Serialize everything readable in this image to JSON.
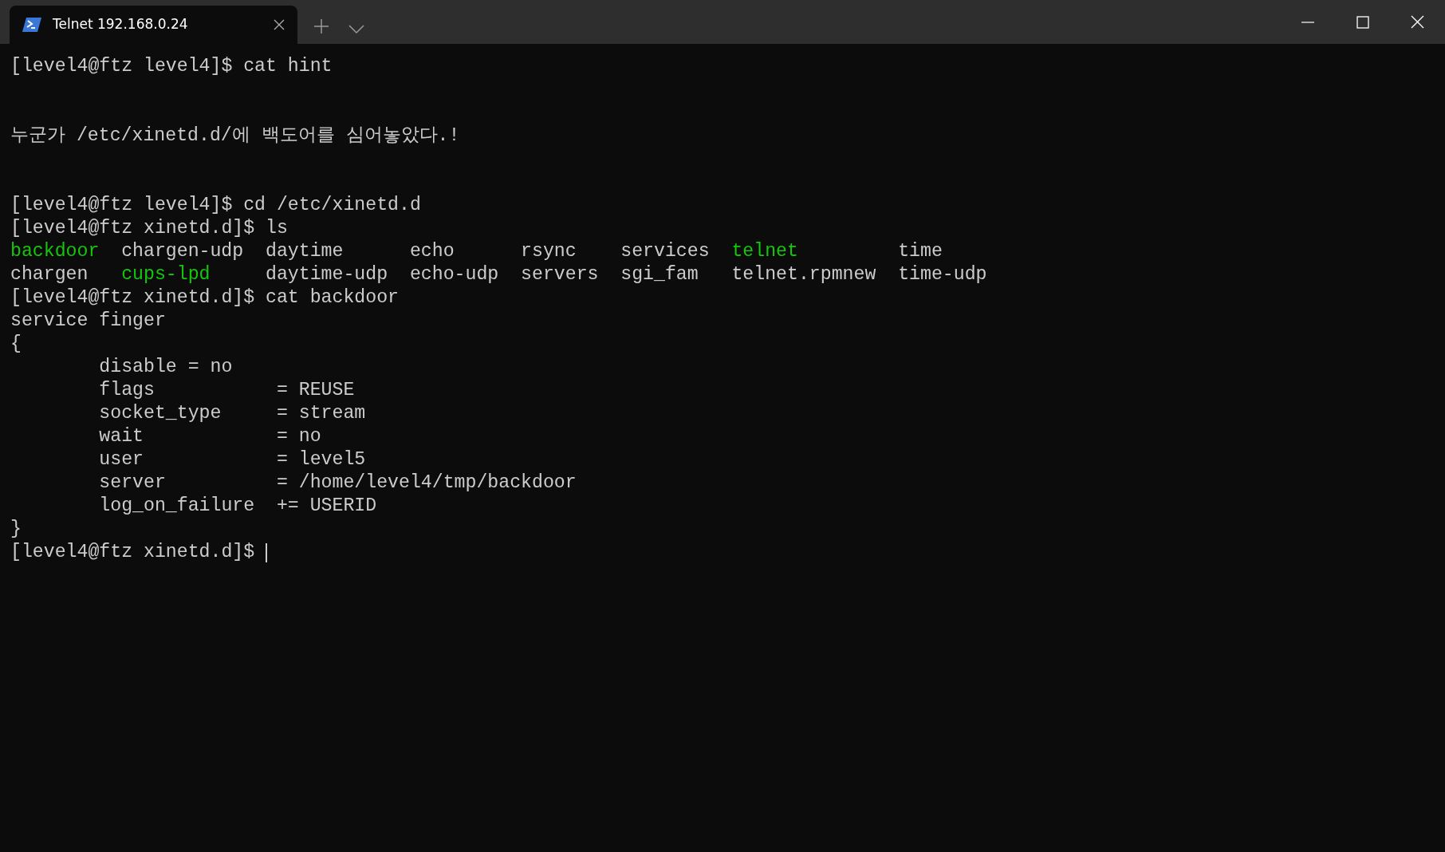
{
  "tab": {
    "title": "Telnet 192.168.0.24",
    "selected": true
  },
  "lines": [
    {
      "kind": "text",
      "text": "[level4@ftz level4]$ cat hint"
    },
    {
      "kind": "blank"
    },
    {
      "kind": "blank"
    },
    {
      "kind": "text",
      "text": "누군가 /etc/xinetd.d/에 백도어를 심어놓았다.!"
    },
    {
      "kind": "blank"
    },
    {
      "kind": "blank"
    },
    {
      "kind": "text",
      "text": "[level4@ftz level4]$ cd /etc/xinetd.d"
    },
    {
      "kind": "text",
      "text": "[level4@ftz xinetd.d]$ ls"
    },
    {
      "kind": "columns",
      "cells": [
        {
          "text": "backdoor",
          "color": "#16c60c"
        },
        {
          "text": "chargen-udp",
          "color": "#cccccc"
        },
        {
          "text": "daytime",
          "color": "#cccccc"
        },
        {
          "text": "echo",
          "color": "#cccccc"
        },
        {
          "text": "rsync",
          "color": "#cccccc"
        },
        {
          "text": "services",
          "color": "#cccccc"
        },
        {
          "text": "telnet",
          "color": "#16c60c"
        },
        {
          "text": "time",
          "color": "#cccccc"
        }
      ]
    },
    {
      "kind": "columns",
      "cells": [
        {
          "text": "chargen",
          "color": "#cccccc"
        },
        {
          "text": "cups-lpd",
          "color": "#16c60c"
        },
        {
          "text": "daytime-udp",
          "color": "#cccccc"
        },
        {
          "text": "echo-udp",
          "color": "#cccccc"
        },
        {
          "text": "servers",
          "color": "#cccccc"
        },
        {
          "text": "sgi_fam",
          "color": "#cccccc"
        },
        {
          "text": "telnet.rpmnew",
          "color": "#cccccc"
        },
        {
          "text": "time-udp",
          "color": "#cccccc"
        }
      ]
    },
    {
      "kind": "text",
      "text": "[level4@ftz xinetd.d]$ cat backdoor"
    },
    {
      "kind": "text",
      "text": "service finger"
    },
    {
      "kind": "text",
      "text": "{"
    },
    {
      "kind": "text",
      "text": "        disable = no"
    },
    {
      "kind": "text",
      "text": "        flags           = REUSE"
    },
    {
      "kind": "text",
      "text": "        socket_type     = stream"
    },
    {
      "kind": "text",
      "text": "        wait            = no"
    },
    {
      "kind": "text",
      "text": "        user            = level5"
    },
    {
      "kind": "text",
      "text": "        server          = /home/level4/tmp/backdoor"
    },
    {
      "kind": "text",
      "text": "        log_on_failure  += USERID"
    },
    {
      "kind": "text",
      "text": "}"
    },
    {
      "kind": "text",
      "text": "[level4@ftz xinetd.d]$ ",
      "cursor": true
    }
  ]
}
